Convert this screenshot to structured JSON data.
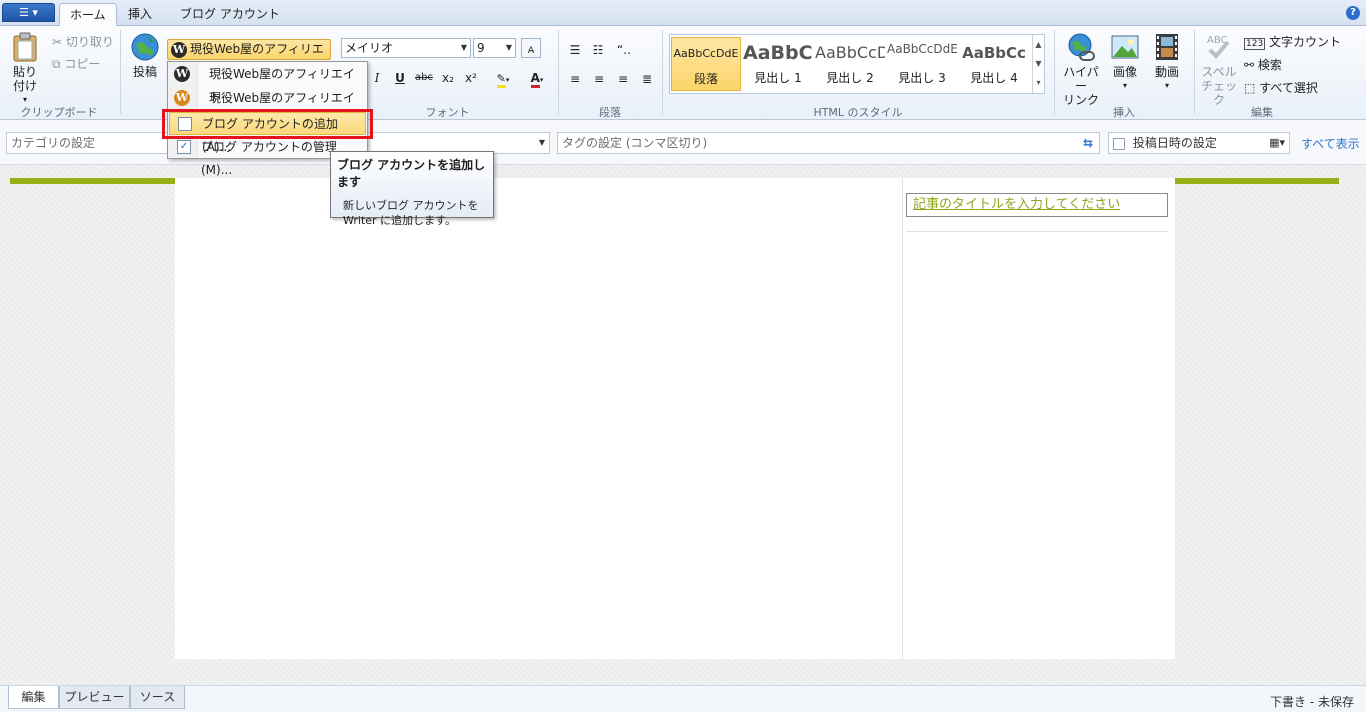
{
  "tabs": {
    "app_menu": "☰ ▾",
    "home": "ホーム",
    "insert": "挿入",
    "blog_account": "ブログ アカウント",
    "help": "?"
  },
  "clipboard": {
    "paste": "貼り付け",
    "paste_arrow": "▾",
    "cut": "切り取り",
    "copy": "コピー",
    "label": "クリップボード"
  },
  "post": {
    "label": "投稿"
  },
  "account": {
    "selected": "現役Web屋のアフィリエイト",
    "menu": [
      "現役Web屋のアフィリエイト",
      "現役Web屋のアフィリエイト",
      "ブログ アカウントの追加(A)...",
      "ブログ アカウントの管理(M)..."
    ]
  },
  "tooltip": {
    "title": "ブログ アカウントを追加します",
    "body_line1": "新しいブログ アカウントを",
    "body_line2": "Writer に追加します。"
  },
  "font": {
    "name": "メイリオ",
    "size": "9",
    "label": "フォント",
    "italic": "I",
    "underline": "U",
    "strike": "abc",
    "sub": "x₂",
    "sup": "x²",
    "color": "A"
  },
  "paragraph": {
    "label": "段落"
  },
  "styles": {
    "label": "HTML のスタイル",
    "items": [
      {
        "sample": "AaBbCcDdE",
        "name": "段落"
      },
      {
        "sample": "AaBbCc",
        "name": "見出し 1"
      },
      {
        "sample": "AaBbCcD",
        "name": "見出し 2"
      },
      {
        "sample": "AaBbCcDdE",
        "name": "見出し 3"
      },
      {
        "sample": "AaBbCc",
        "name": "見出し 4"
      }
    ]
  },
  "insert_group": {
    "hyperlink_line1": "ハイパー",
    "hyperlink_line2": "リンク",
    "image": "画像",
    "video": "動画",
    "label": "挿入"
  },
  "edit_group": {
    "spell_line1": "スペル",
    "spell_line2": "チェック",
    "word_count": "文字カウント",
    "search": "検索",
    "select_all": "すべて選択",
    "label": "編集"
  },
  "properties": {
    "category_placeholder": "カテゴリの設定",
    "tags_placeholder": "タグの設定 (コンマ区切り)",
    "date_label": "投稿日時の設定",
    "show_all": "すべて表示"
  },
  "editor": {
    "title_placeholder": "記事のタイトルを入力してください"
  },
  "bottom_tabs": [
    "編集",
    "プレビュー",
    "ソース"
  ],
  "status": "下書き - 未保存",
  "colors": {
    "accent_green": "#95b117",
    "highlight": "#fbd46a",
    "red_box": "#e2141c"
  }
}
